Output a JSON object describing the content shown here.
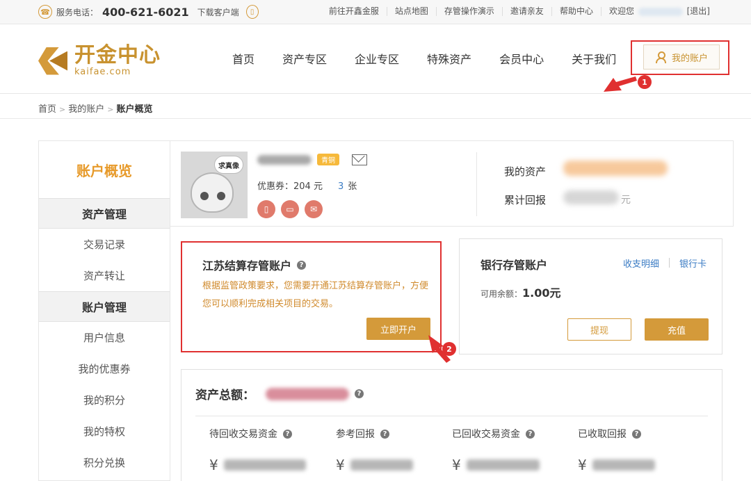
{
  "topbar": {
    "phone_label": "服务电话：",
    "phone_number": "400-621-6021",
    "download_label": "下载客户端",
    "links": [
      "前往开鑫金服",
      "站点地图",
      "存管操作演示",
      "邀请亲友",
      "帮助中心"
    ],
    "welcome": "欢迎您",
    "logout": "[退出]"
  },
  "header": {
    "logo_cn": "开金中心",
    "logo_en": "kaifae.com",
    "nav": [
      "首页",
      "资产专区",
      "企业专区",
      "特殊资产",
      "会员中心",
      "关于我们"
    ],
    "account_button": "我的账户"
  },
  "breadcrumb": {
    "items": [
      "首页",
      "我的账户"
    ],
    "current": "账户概览",
    "separator": ">"
  },
  "sidebar": {
    "title": "账户概览",
    "group1": "资产管理",
    "group1_items": [
      "交易记录",
      "资产转让"
    ],
    "group2": "账户管理",
    "group2_items": [
      "用户信息",
      "我的优惠券",
      "我的积分",
      "我的特权",
      "积分兑换"
    ]
  },
  "profile": {
    "avatar_bubble": "求真像",
    "vip_label": "青铜",
    "coupon_label": "优惠券：204 元",
    "coupon_count": "3",
    "coupon_unit": "张",
    "assets_label": "我的资产",
    "returns_label": "累计回报",
    "returns_unit": "元"
  },
  "custody_card": {
    "title": "江苏结算存管账户",
    "description": "根据监管政策要求，您需要开通江苏结算存管账户，方便您可以顺利完成相关项目的交易。",
    "open_button": "立即开户"
  },
  "bank_card": {
    "title": "银行存管账户",
    "link_detail": "收支明细",
    "link_card": "银行卡",
    "balance_label": "可用余额：",
    "balance_value": "1.00元",
    "withdraw_button": "提现",
    "deposit_button": "充值"
  },
  "total": {
    "title": "资产总额：",
    "stats": [
      "待回收交易资金",
      "参考回报",
      "已回收交易资金",
      "已收取回报"
    ],
    "currency": "¥"
  },
  "markers": [
    "1",
    "2"
  ],
  "colors": {
    "accent": "#d49a3a",
    "link": "#3b7cc4",
    "highlight": "#e03030"
  }
}
